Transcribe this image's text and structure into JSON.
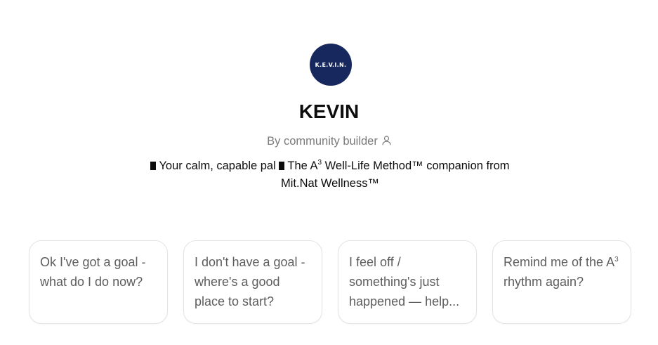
{
  "gpt": {
    "avatar_text": "K.E.V.I.N.",
    "name": "KEVIN",
    "byline": "By community builder",
    "description": {
      "part1": "Your calm, capable pal",
      "part2": "The A",
      "sup": "3",
      "part3": " Well-Life Method™ companion from Mit.Nat Wellness™"
    }
  },
  "starters": [
    {
      "text": "Ok I've got a goal - what do I do now?"
    },
    {
      "text": "I don't have a goal - where's a good place to start?"
    },
    {
      "text": "I feel off / something's just happened — help..."
    },
    {
      "pre": "Remind me of the A",
      "sup": "3",
      "post": " rhythm again?"
    }
  ],
  "colors": {
    "avatar_bg": "#17285e",
    "text_primary": "#0d0d0d",
    "text_secondary": "#7a7a7a",
    "card_border": "#e3e3e3"
  },
  "icons": {
    "byline": "person-icon"
  }
}
